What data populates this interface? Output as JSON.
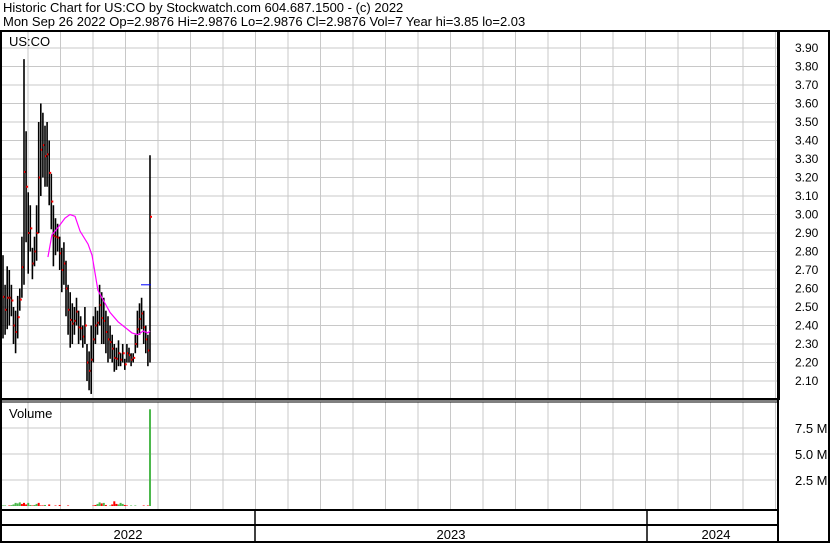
{
  "header": {
    "line1": "Historic Chart for US:CO by Stockwatch.com 604.687.1500 - (c) 2022",
    "line2": "Mon Sep 26 2022   Op=2.9876  Hi=2.9876  Lo=2.9876  Cl=2.9876  Vol=7  Year hi=3.85  lo=2.03"
  },
  "chart_data": {
    "type": "ohlc",
    "symbol_label": "US:CO",
    "price_axis": {
      "min": 2.0,
      "max": 3.95,
      "ticks": [
        "3.90",
        "3.80",
        "3.70",
        "3.60",
        "3.50",
        "3.40",
        "3.30",
        "3.20",
        "3.10",
        "3.00",
        "2.90",
        "2.80",
        "2.70",
        "2.60",
        "2.50",
        "2.40",
        "2.30",
        "2.20",
        "2.10"
      ]
    },
    "volume_label": "Volume",
    "volume_axis": {
      "max_m": 10.4,
      "ticks": [
        {
          "v": 7.5,
          "label": "7.5 M"
        },
        {
          "v": 5.0,
          "label": "5.0 M"
        },
        {
          "v": 2.5,
          "label": "2.5 M"
        }
      ]
    },
    "years": [
      "2022",
      "2023",
      "2024"
    ],
    "colors": {
      "bar": "#000000",
      "close": "#ff0000",
      "ma": "#ff00ff",
      "grid": "#c8c8c8",
      "vol_up": "#4cb84c",
      "vol_down": "#ff0000",
      "last_marker": "#0000ff"
    },
    "bars": [
      [
        2.78,
        2.33
      ],
      [
        2.62,
        2.35
      ],
      [
        2.72,
        2.38
      ],
      [
        2.7,
        2.4
      ],
      [
        2.62,
        2.45
      ],
      [
        2.5,
        2.3
      ],
      [
        2.48,
        2.25
      ],
      [
        2.56,
        2.33
      ],
      [
        2.6,
        2.48
      ],
      [
        2.88,
        2.55
      ],
      [
        3.84,
        2.62
      ],
      [
        3.45,
        2.85
      ],
      [
        3.12,
        2.68
      ],
      [
        3.05,
        2.8
      ],
      [
        2.82,
        2.65
      ],
      [
        2.88,
        2.72
      ],
      [
        3.05,
        2.75
      ],
      [
        3.5,
        2.9
      ],
      [
        3.6,
        3.1
      ],
      [
        3.55,
        3.2
      ],
      [
        3.48,
        3.15
      ],
      [
        3.5,
        3.15
      ],
      [
        3.4,
        3.05
      ],
      [
        3.22,
        2.92
      ],
      [
        3.05,
        2.72
      ],
      [
        2.98,
        2.78
      ],
      [
        2.95,
        2.8
      ],
      [
        2.88,
        2.7
      ],
      [
        2.82,
        2.58
      ],
      [
        2.85,
        2.62
      ],
      [
        2.75,
        2.45
      ],
      [
        2.62,
        2.35
      ],
      [
        2.58,
        2.28
      ],
      [
        2.52,
        2.3
      ],
      [
        2.5,
        2.35
      ],
      [
        2.55,
        2.4
      ],
      [
        2.48,
        2.3
      ],
      [
        2.45,
        2.32
      ],
      [
        2.4,
        2.28
      ],
      [
        2.5,
        2.3
      ],
      [
        2.3,
        2.1
      ],
      [
        2.26,
        2.05
      ],
      [
        2.4,
        2.03
      ],
      [
        2.45,
        2.2
      ],
      [
        2.5,
        2.3
      ],
      [
        2.48,
        2.35
      ],
      [
        2.62,
        2.4
      ],
      [
        2.58,
        2.3
      ],
      [
        2.55,
        2.3
      ],
      [
        2.48,
        2.25
      ],
      [
        2.45,
        2.2
      ],
      [
        2.4,
        2.22
      ],
      [
        2.35,
        2.2
      ],
      [
        2.3,
        2.15
      ],
      [
        2.28,
        2.16
      ],
      [
        2.32,
        2.18
      ],
      [
        2.25,
        2.18
      ],
      [
        2.3,
        2.2
      ],
      [
        2.22,
        2.16
      ],
      [
        2.3,
        2.2
      ],
      [
        2.28,
        2.2
      ],
      [
        2.25,
        2.18
      ],
      [
        2.25,
        2.2
      ],
      [
        2.35,
        2.25
      ],
      [
        2.48,
        2.28
      ],
      [
        2.52,
        2.35
      ],
      [
        2.55,
        2.38
      ],
      [
        2.48,
        2.3
      ],
      [
        2.4,
        2.25
      ],
      [
        2.35,
        2.18
      ],
      [
        3.32,
        2.2
      ]
    ],
    "last_close": 2.9876,
    "last_marker_value": 2.62,
    "moving_average": [
      [
        21.4,
        2.77
      ],
      [
        23.3,
        2.89
      ],
      [
        26.2,
        2.93
      ],
      [
        29.5,
        2.98
      ],
      [
        31.9,
        3.0
      ],
      [
        34.3,
        2.99
      ],
      [
        36.7,
        2.91
      ],
      [
        40.5,
        2.84
      ],
      [
        42.4,
        2.78
      ],
      [
        45.2,
        2.59
      ],
      [
        47.6,
        2.54
      ],
      [
        51,
        2.47
      ],
      [
        54.8,
        2.42
      ],
      [
        58.1,
        2.39
      ],
      [
        61.4,
        2.36
      ],
      [
        64.3,
        2.35
      ],
      [
        66.7,
        2.37
      ],
      [
        69,
        2.36
      ],
      [
        70,
        2.37
      ]
    ],
    "volume_m": [
      0.05,
      0.05,
      0.0,
      0.05,
      0.08,
      0.15,
      0.3,
      0.25,
      0.35,
      0.2,
      0.3,
      0.15,
      0.3,
      0.1,
      0.05,
      0.1,
      0.2,
      0.3,
      0.05,
      0.05,
      0.1,
      0.0,
      0.15,
      0.0,
      0.0,
      0.05,
      0.0,
      0.1,
      0.0,
      0.0,
      0.0,
      0.05,
      0.0,
      0.0,
      0.0,
      0.0,
      0.0,
      0.0,
      0.0,
      0.0,
      0.0,
      0.0,
      0.0,
      0.05,
      0.1,
      0.2,
      0.35,
      0.25,
      0.3,
      0.1,
      0.0,
      0.05,
      0.15,
      0.45,
      0.2,
      0.15,
      0.3,
      0.2,
      0.1,
      0.05,
      0.0,
      0.05,
      0.0,
      0.05,
      0.0,
      0.0,
      0.0,
      0.05,
      0.0,
      0.05,
      9.3
    ],
    "volume_up": [
      1,
      1,
      0,
      0,
      1,
      1,
      1,
      1,
      1,
      0,
      0,
      0,
      1,
      1,
      0,
      1,
      1,
      0,
      0,
      0,
      1,
      0,
      0,
      0,
      0,
      0,
      0,
      0,
      0,
      0,
      0,
      0,
      0,
      0,
      0,
      0,
      0,
      0,
      0,
      0,
      0,
      0,
      0,
      0,
      0,
      1,
      1,
      0,
      1,
      0,
      0,
      1,
      0,
      0,
      0,
      1,
      1,
      1,
      0,
      0,
      0,
      1,
      0,
      1,
      0,
      0,
      0,
      0,
      0,
      0,
      1
    ]
  }
}
